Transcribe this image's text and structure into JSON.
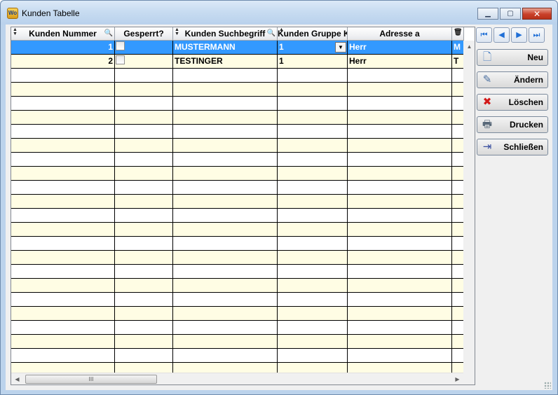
{
  "window": {
    "title": "Kunden Tabelle",
    "app_icon_text": "Wo"
  },
  "columns": [
    {
      "label": "Kunden Nummer",
      "width": 148
    },
    {
      "label": "Gesperrt?",
      "width": 83
    },
    {
      "label": "Kunden Suchbegriff",
      "width": 149
    },
    {
      "label": "Kunden Gruppe K",
      "width": 100
    },
    {
      "label": "Adresse a",
      "width": 149
    },
    {
      "label": "",
      "width": 17
    }
  ],
  "rows": [
    {
      "nummer": "1",
      "gesperrt": false,
      "suchbegriff": "MUSTERMANN",
      "gruppe": "1",
      "adresse": "Herr",
      "extra": "M",
      "selected": true
    },
    {
      "nummer": "2",
      "gesperrt": false,
      "suchbegriff": "TESTINGER",
      "gruppe": "1",
      "adresse": "Herr",
      "extra": "T",
      "selected": false
    }
  ],
  "empty_rows": 22,
  "scrollbar": {
    "thumb_glyph": "III"
  },
  "nav_buttons": [
    "first",
    "previous",
    "next",
    "last"
  ],
  "actions": [
    {
      "id": "neu",
      "label": "Neu",
      "icon": "new-document-icon"
    },
    {
      "id": "aendern",
      "label": "Ändern",
      "icon": "edit-icon"
    },
    {
      "id": "loeschen",
      "label": "Löschen",
      "icon": "delete-x-icon"
    },
    {
      "id": "drucken",
      "label": "Drucken",
      "icon": "printer-icon"
    },
    {
      "id": "schliessen",
      "label": "Schließen",
      "icon": "exit-door-icon"
    }
  ],
  "colors": {
    "selection": "#3399ff",
    "row_alt": "#fffde4",
    "close_button": "#c9402a"
  }
}
